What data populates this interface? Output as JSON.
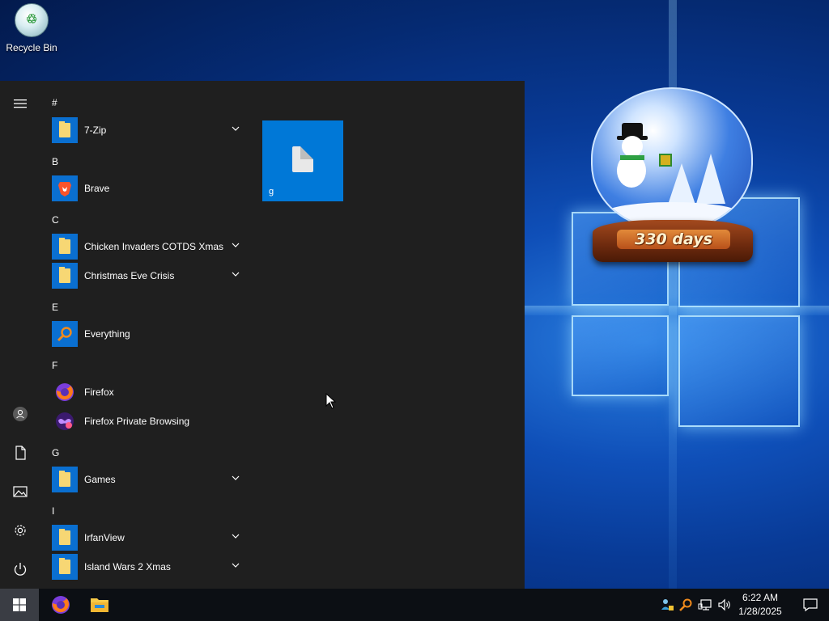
{
  "desktop": {
    "recycle_bin_label": "Recycle Bin",
    "widget_days": "330 days"
  },
  "start_menu": {
    "sections": [
      {
        "letter": "#",
        "apps": [
          {
            "name": "7-Zip",
            "icon": "folder-icon",
            "expandable": true
          }
        ]
      },
      {
        "letter": "B",
        "apps": [
          {
            "name": "Brave",
            "icon": "brave-icon",
            "expandable": false
          }
        ]
      },
      {
        "letter": "C",
        "apps": [
          {
            "name": "Chicken Invaders COTDS Xmas",
            "icon": "folder-icon",
            "expandable": true
          },
          {
            "name": "Christmas Eve Crisis",
            "icon": "folder-icon",
            "expandable": true
          }
        ]
      },
      {
        "letter": "E",
        "apps": [
          {
            "name": "Everything",
            "icon": "search-magnifier-icon",
            "expandable": false
          }
        ]
      },
      {
        "letter": "F",
        "apps": [
          {
            "name": "Firefox",
            "icon": "firefox-icon",
            "expandable": false
          },
          {
            "name": "Firefox Private Browsing",
            "icon": "firefox-private-icon",
            "expandable": false
          }
        ]
      },
      {
        "letter": "G",
        "apps": [
          {
            "name": "Games",
            "icon": "folder-icon",
            "expandable": true
          }
        ]
      },
      {
        "letter": "I",
        "apps": [
          {
            "name": "IrfanView",
            "icon": "folder-icon",
            "expandable": true
          },
          {
            "name": "Island Wars 2 Xmas",
            "icon": "folder-icon",
            "expandable": true
          }
        ]
      }
    ],
    "tiles": [
      {
        "label": "g",
        "icon": "document-icon"
      }
    ],
    "rail": [
      "hamburger-menu-icon",
      "user-avatar-icon",
      "documents-icon",
      "pictures-icon",
      "settings-gear-icon",
      "power-icon"
    ]
  },
  "taskbar": {
    "pinned": [
      "windows-start-icon",
      "firefox-icon",
      "file-explorer-icon"
    ],
    "tray_icons": [
      "network-user-icon",
      "everything-search-icon",
      "network-icon",
      "volume-icon"
    ],
    "time": "6:22 AM",
    "date": "1/28/2025"
  },
  "colors": {
    "start_bg": "#1f1f1f",
    "accent": "#0078d7",
    "taskbar_bg": "#0c0f14"
  }
}
